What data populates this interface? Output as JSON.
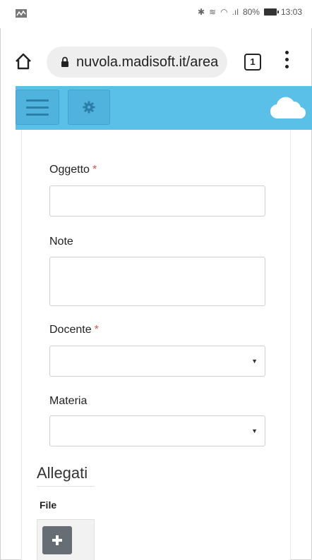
{
  "status_bar": {
    "battery": "80%",
    "time": "13:03"
  },
  "browser": {
    "url": "nuvola.madisoft.it/area",
    "tab_count": "1"
  },
  "app": {
    "accent_color": "#5bc0e8"
  },
  "form": {
    "oggetto_label": "Oggetto",
    "note_label": "Note",
    "docente_label": "Docente",
    "materia_label": "Materia",
    "required_marker": "*",
    "oggetto_value": "",
    "note_value": "",
    "docente_value": "",
    "materia_value": ""
  },
  "attachments": {
    "title": "Allegati",
    "file_label": "File"
  },
  "icons": [
    "signal-icon",
    "bluetooth-icon",
    "wifi-icon",
    "battery-icon",
    "home-icon",
    "lock-icon",
    "tabs-icon",
    "menu-dots-icon",
    "hamburger-icon",
    "gear-icon",
    "cloud-icon",
    "plus-icon",
    "chevron-down-icon"
  ]
}
